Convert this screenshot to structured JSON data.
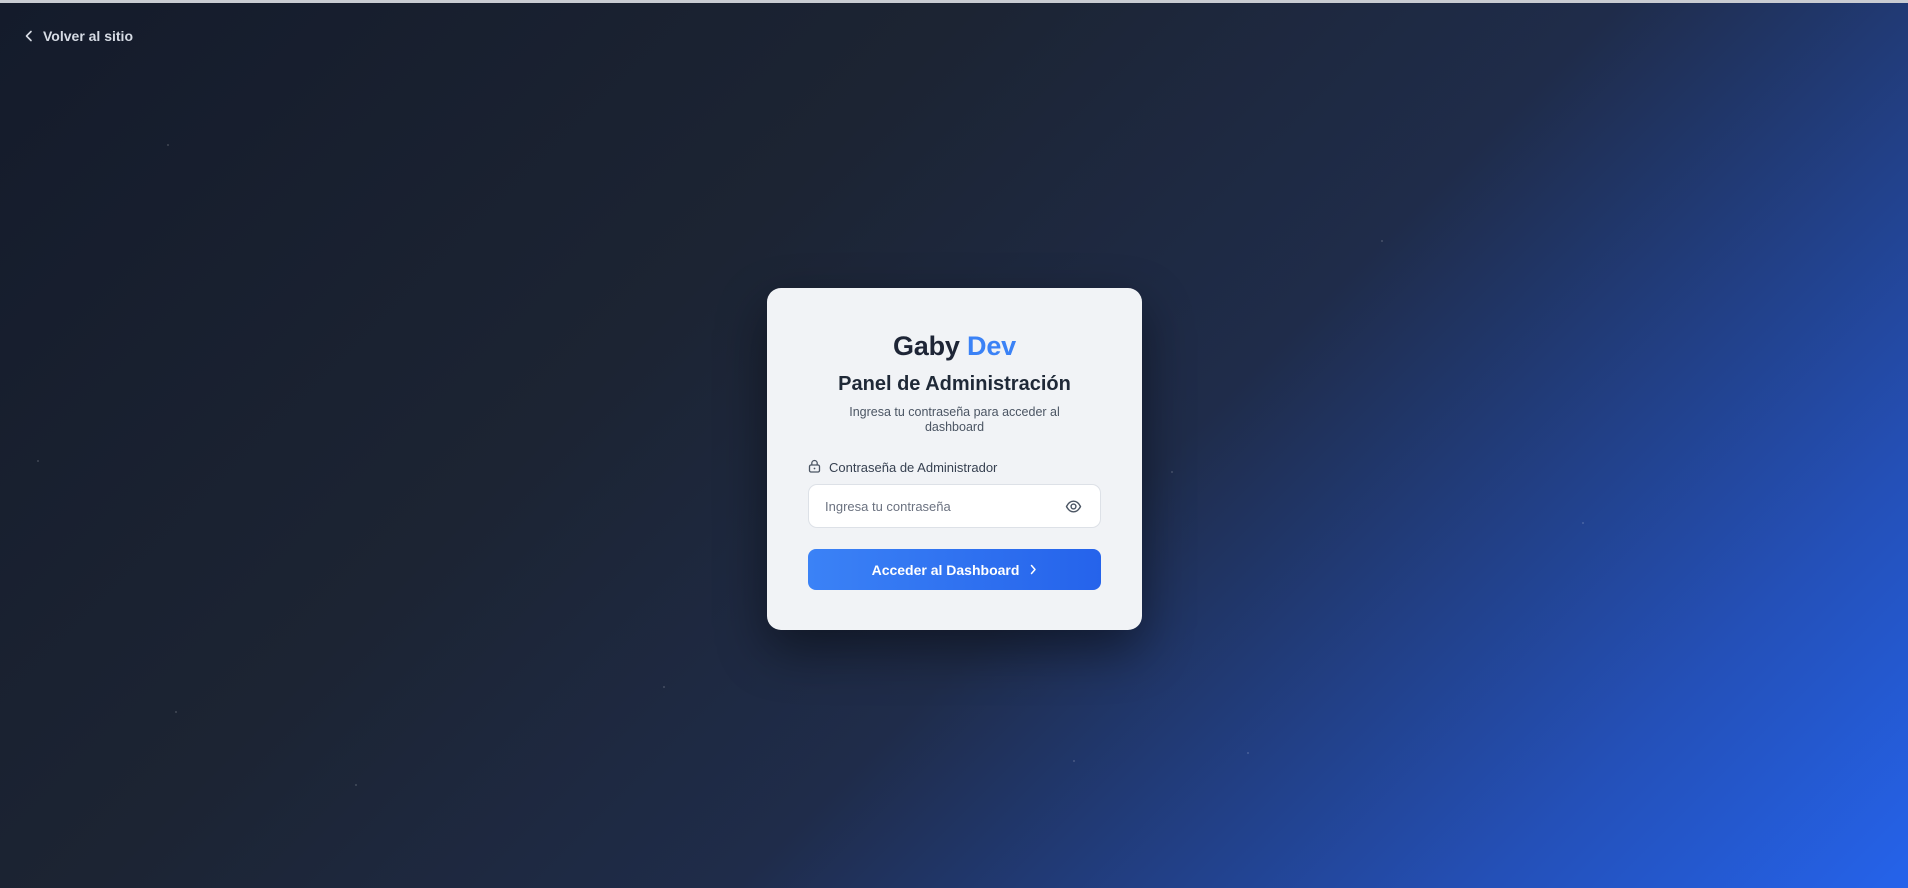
{
  "back_link": {
    "label": "Volver al sitio",
    "icon": "chevron-left-icon"
  },
  "card": {
    "brand_primary": "Gaby",
    "brand_accent": "Dev",
    "title": "Panel de Administración",
    "subtitle": "Ingresa tu contraseña para acceder al dashboard",
    "password_label": "Contraseña de Administrador",
    "password_placeholder": "Ingresa tu contraseña",
    "password_value": "",
    "submit_label": "Acceder al Dashboard"
  },
  "colors": {
    "accent": "#3b82f6",
    "button_gradient_end": "#2563eb",
    "card_bg": "#f1f3f6",
    "text_dark": "#1e2536"
  }
}
